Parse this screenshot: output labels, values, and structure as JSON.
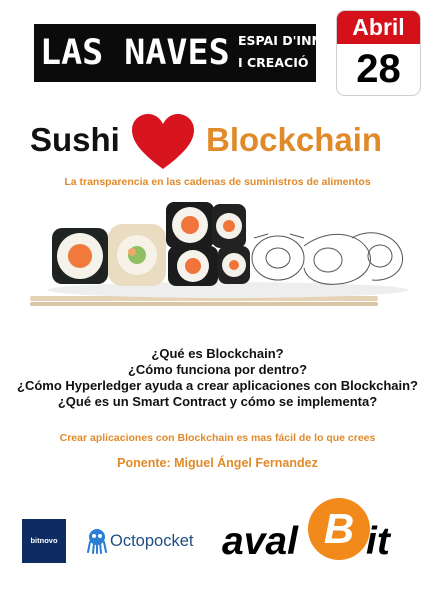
{
  "header": {
    "logo_main": "LAS NAVES",
    "logo_tag_line1": "ESPAI D'INNOVACIÓ",
    "logo_tag_line2": "I CREACIÓ"
  },
  "date": {
    "month": "Abril",
    "day": "28"
  },
  "title": {
    "part1": "Sushi",
    "heart_icon": "heart-icon",
    "part2": "Blockchain"
  },
  "subtitle": "La transparencia en las cadenas de suministros de alimentos",
  "questions": [
    "¿Qué es Blockchain?",
    "¿Cómo funciona por dentro?",
    "¿Cómo Hyperledger ayuda a crear aplicaciones con Blockchain?",
    "¿Qué es un Smart Contract y cómo se implementa?"
  ],
  "tagline": "Crear aplicaciones con Blockchain es mas fácil de lo que crees",
  "speaker": "Ponente: Miguel Ángel Fernandez",
  "sponsors": {
    "bitnovo": "bitnovo",
    "octopocket": "Octopocket",
    "avalbit_left": "aval",
    "avalbit_coin": "B",
    "avalbit_right": "it"
  },
  "colors": {
    "accent": "#e08a2a",
    "calendar_red": "#d4101a",
    "heart_red": "#d8151f",
    "bitnovo_blue": "#0d2c63",
    "octopocket_blue": "#1d4e84",
    "avalbit_orange": "#f28a1b"
  }
}
